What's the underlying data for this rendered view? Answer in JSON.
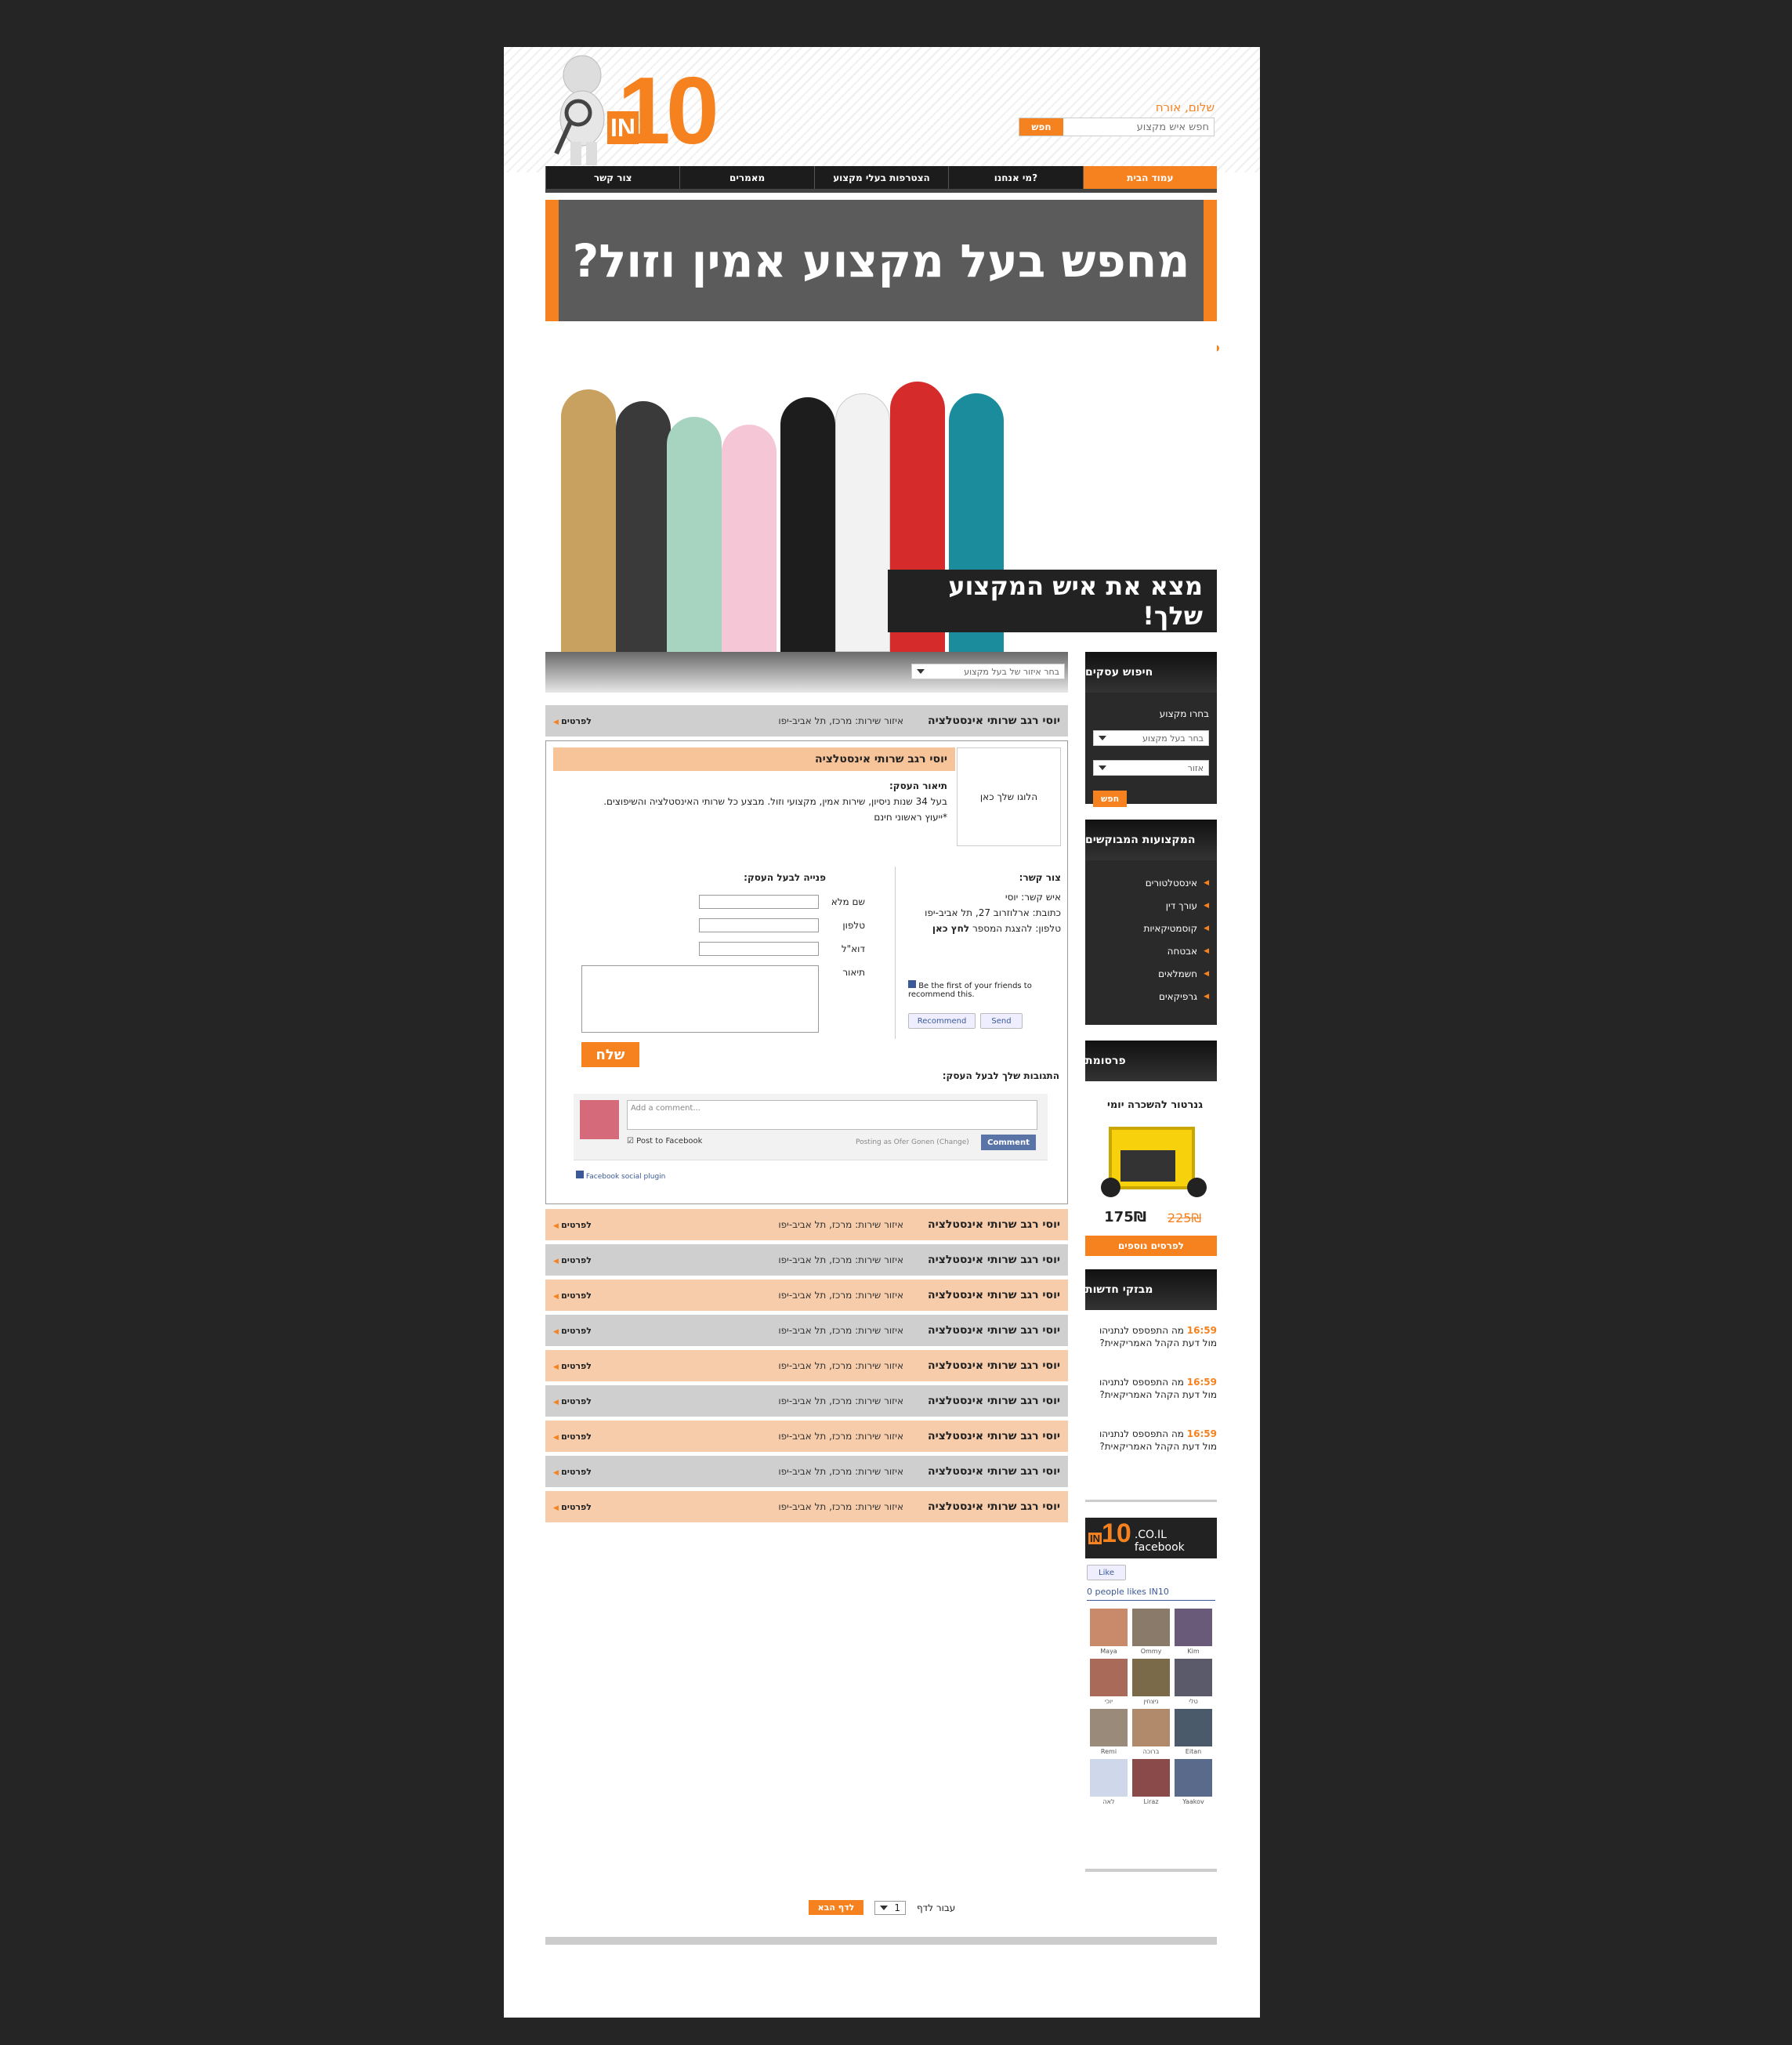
{
  "header": {
    "logo_text": "10",
    "logo_in": "IN",
    "greeting": "שלום, אורח",
    "search_placeholder": "חפש איש מקצוע",
    "search_button": "חפש"
  },
  "nav": [
    "עמוד הבית",
    "מי אנחנו?",
    "הצטרפות בעלי מקצוע",
    "מאמרים",
    "צור קשר"
  ],
  "banner": {
    "text": "מחפש בעל מקצוע אמין וזול?"
  },
  "hero": {
    "tagline": "מצא את איש המקצוע שלך!"
  },
  "filter": {
    "area_select": "בחר איזור של בעל מקצוע"
  },
  "listing": {
    "name": "יוסי רגב שרותי אינסטלציה",
    "area": "איזור שירות: מרכז, תל אביב-יפו",
    "details": "לפרטים"
  },
  "card": {
    "title": "יוסי רגב שרותי אינסטלציה",
    "logo_placeholder": "הלוגו שלך כאן",
    "desc_label": "תיאור העסק:",
    "desc_text": "בעל 34 שנות ניסיון, שירות אמין, מקצועי וזול. מבצע כל שרותי האינסטלציה והשיפוצים.",
    "desc_text2": "*ייעוץ ראשוני חינם",
    "contact_label": "צור קשר:",
    "contact_person": "איש קשר: יוסי",
    "contact_address": "כתובת: ארלוזרוב 27, תל אביב-יפו",
    "contact_phone": "טלפון: להצגת המספר",
    "contact_phone_link": "לחץ כאן",
    "form_label": "פנייה לבעל העסק:",
    "f_name": "שם מלא",
    "f_phone": "טלפון",
    "f_email": "דוא\"ל",
    "f_desc": "תיאור",
    "send": "שלח",
    "fb_recommend_text": "Be the first of your friends to recommend this.",
    "fb_recommend": "Recommend",
    "fb_send": "Send",
    "comments_label": "התגובות שלך לבעל העסק:",
    "comment_placeholder": "Add a comment...",
    "post_to_fb": "Post to Facebook",
    "posting_as": "Posting as Ofer Gonen (Change)",
    "comment_btn": "Comment",
    "fb_plugin": "Facebook social plugin"
  },
  "rows_colors": [
    "o",
    "g",
    "o",
    "g",
    "o",
    "g",
    "o",
    "g",
    "o"
  ],
  "sidebar": {
    "search_title": "חיפוש עסקים",
    "choose_prof": "בחרו מקצוע",
    "sel_prof": "בחר בעל מקצוע",
    "sel_area": "אזור",
    "search_btn": "חפש",
    "popular_title": "המקצועות המבוקשים",
    "popular": [
      "אינסטלטורים",
      "עורך דין",
      "קוסמטיקאיות",
      "אבטחה",
      "חשמלאים",
      "גרפיקאים"
    ],
    "promo_title": "פרסומת",
    "promo_item": "גנרטור להשכרה יומי",
    "promo_old": "225₪",
    "promo_new": "175₪",
    "promo_more": "לפרסים נוספים",
    "news_title": "מבזקי חדשות",
    "news": [
      {
        "time": "16:59",
        "text": "מה התפספס לנתניהו מול דעת הקהל האמריקאית?"
      },
      {
        "time": "16:59",
        "text": "מה התפספס לנתניהו מול דעת הקהל האמריקאית?"
      },
      {
        "time": "16:59",
        "text": "מה התפספס לנתניהו מול דעת הקהל האמריקאית?"
      }
    ],
    "fb_site": ".CO.IL facebook",
    "fb_like": "Like",
    "fb_count": "0 people likes IN10",
    "fans": [
      "Maya",
      "Ommy",
      "Kim",
      "יוכי",
      "ניצחין",
      "טלי",
      "Remi",
      "ברוכה",
      "Eitan",
      "לאה",
      "Liraz",
      "Yaakov"
    ]
  },
  "pager": {
    "goto": "עבור לדף",
    "page": "1",
    "next": "לדף הבא"
  }
}
